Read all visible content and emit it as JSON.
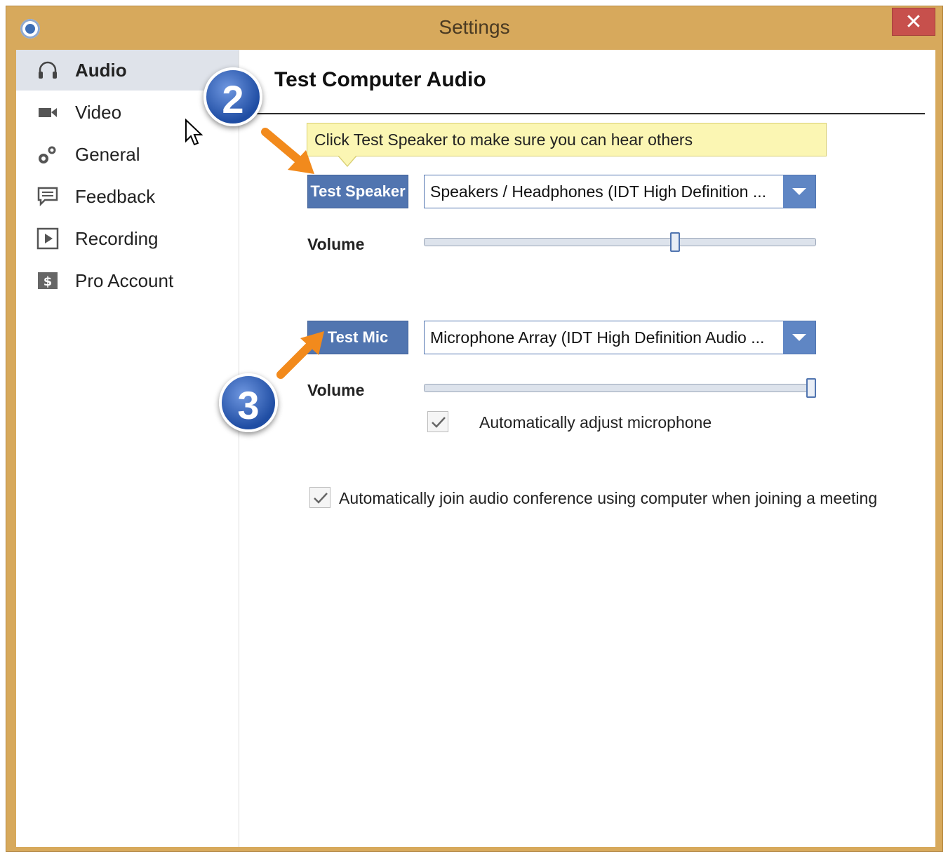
{
  "window": {
    "title": "Settings",
    "close_label": "✕"
  },
  "sidebar": {
    "items": [
      {
        "label": "Audio",
        "icon": "headphones-icon",
        "active": true
      },
      {
        "label": "Video",
        "icon": "camera-icon"
      },
      {
        "label": "General",
        "icon": "gears-icon"
      },
      {
        "label": "Feedback",
        "icon": "speech-bubble-icon"
      },
      {
        "label": "Recording",
        "icon": "play-icon"
      },
      {
        "label": "Pro Account",
        "icon": "dollar-icon"
      }
    ]
  },
  "main": {
    "title": "Test Computer Audio",
    "tooltip": "Click Test Speaker to make sure you can hear others",
    "speaker": {
      "button_label": "Test Speaker",
      "device": "Speakers / Headphones (IDT High Definition ...",
      "volume_label": "Volume",
      "volume_level": 0.64
    },
    "mic": {
      "button_label": "Test Mic",
      "device": "Microphone Array (IDT High Definition Audio ...",
      "volume_label": "Volume",
      "volume_level": 1.0,
      "auto_adjust_label": "Automatically adjust microphone",
      "auto_adjust_checked": true
    },
    "auto_join_label": "Automatically join audio conference using computer when joining a meeting",
    "auto_join_checked": true
  },
  "annotations": {
    "step2": "2",
    "step3": "3"
  },
  "colors": {
    "titlebar": "#d7a95c",
    "accent": "#5175b0",
    "close": "#c7504c",
    "arrow": "#f28a1c"
  }
}
